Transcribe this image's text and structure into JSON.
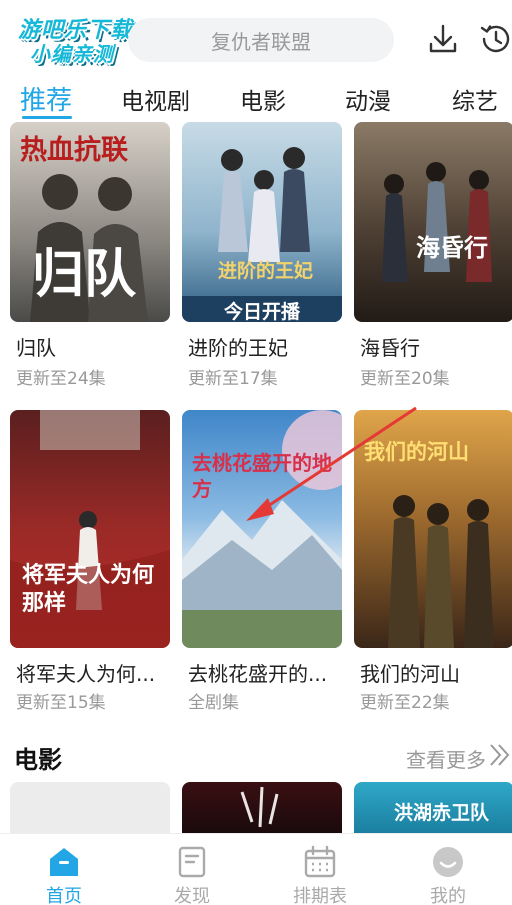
{
  "watermark": {
    "line1": "游吧乐下载",
    "line2": "小编亲测"
  },
  "search": {
    "placeholder": "复仇者联盟"
  },
  "icons": {
    "download": "download-icon",
    "history": "history-clock-icon"
  },
  "tabs": [
    {
      "label": "推荐",
      "active": true
    },
    {
      "label": "电视剧",
      "active": false
    },
    {
      "label": "电影",
      "active": false
    },
    {
      "label": "动漫",
      "active": false
    },
    {
      "label": "综艺",
      "active": false
    }
  ],
  "rows": [
    [
      {
        "title": "归队",
        "status": "更新至24集",
        "poster_text": [
          "热血抗联",
          "归队"
        ],
        "colors": [
          "#c9c3bb",
          "#4a4a48"
        ]
      },
      {
        "title": "进阶的王妃",
        "status": "更新至17集",
        "poster_text": [
          "进阶的王妃",
          "今日开播"
        ],
        "colors": [
          "#8fb9d0",
          "#2f5f86"
        ]
      },
      {
        "title": "海昏行",
        "status": "更新至20集",
        "poster_text": [
          "海昏行"
        ],
        "colors": [
          "#6d5a4a",
          "#2a2420"
        ]
      }
    ],
    [
      {
        "title": "将军夫人为何...",
        "status": "更新至15集",
        "poster_text": [
          "将军夫人为何那样"
        ],
        "colors": [
          "#8a2a2a",
          "#b22a26"
        ]
      },
      {
        "title": "去桃花盛开的...",
        "status": "全剧集",
        "poster_text": [
          "去桃花盛开的地方"
        ],
        "colors": [
          "#4a8fcc",
          "#7fb0d9"
        ]
      },
      {
        "title": "我们的河山",
        "status": "更新至22集",
        "poster_text": [
          "我们的河山"
        ],
        "colors": [
          "#c28a3a",
          "#3d2a1c"
        ]
      }
    ]
  ],
  "movies_section": {
    "title": "电影",
    "more": "查看更多",
    "posters": [
      {
        "text": "",
        "colors": [
          "#ececec",
          "#ececec"
        ]
      },
      {
        "text": "",
        "colors": [
          "#3a0f12",
          "#1a0a0c"
        ]
      },
      {
        "text": "洪湖赤卫队",
        "colors": [
          "#2fa8c8",
          "#1b7fa0"
        ]
      }
    ]
  },
  "bottom_nav": [
    {
      "label": "首页",
      "active": true,
      "icon": "home-icon"
    },
    {
      "label": "发现",
      "active": false,
      "icon": "discover-icon"
    },
    {
      "label": "排期表",
      "active": false,
      "icon": "calendar-icon"
    },
    {
      "label": "我的",
      "active": false,
      "icon": "profile-icon"
    }
  ],
  "accent_color": "#22a6e6"
}
